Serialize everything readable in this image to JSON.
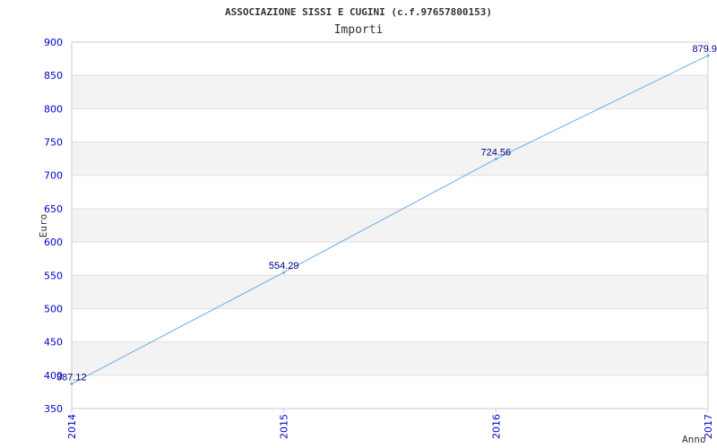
{
  "chart_data": {
    "type": "line",
    "title": "ASSOCIAZIONE SISSI E CUGINI (c.f.97657800153)",
    "subtitle": "Importi",
    "xlabel": "Anno",
    "ylabel": "Euro",
    "x": [
      "2014",
      "2015",
      "2016",
      "2017"
    ],
    "series": [
      {
        "values": [
          387.12,
          554.29,
          724.56,
          879.9
        ],
        "labels": [
          "387.12",
          "554.29",
          "724.56",
          "879.9"
        ]
      }
    ],
    "ylim": [
      350,
      900
    ],
    "yticks": [
      350,
      400,
      450,
      500,
      550,
      600,
      650,
      700,
      750,
      800,
      850,
      900
    ],
    "grid": true,
    "colors": {
      "line": "#6aade4",
      "tick_text": "#0000cc",
      "data_label": "#000088",
      "band": "#f3f3f3"
    }
  }
}
